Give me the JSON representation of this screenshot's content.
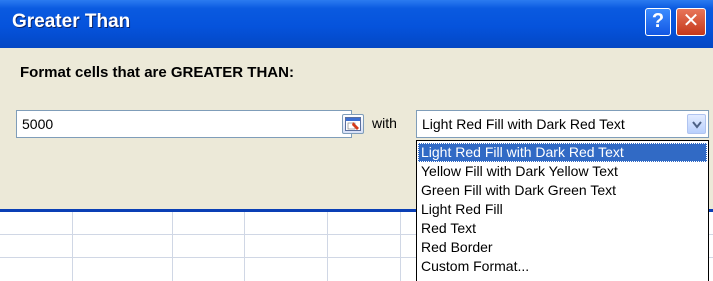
{
  "dialog": {
    "title": "Greater Than",
    "help_glyph": "?",
    "close_glyph": "✕",
    "prompt": "Format cells that are GREATER THAN:",
    "value": "5000",
    "with_label": "with",
    "format_selected": "Light Red Fill with Dark Red Text",
    "format_options": [
      "Light Red Fill with Dark Red Text",
      "Yellow Fill with Dark Yellow Text",
      "Green Fill with Dark Green Text",
      "Light Red Fill",
      "Red Text",
      "Red Border",
      "Custom Format..."
    ],
    "highlighted_index": 0
  },
  "icons": {
    "help": "help-icon",
    "close": "close-icon",
    "collapse": "collapse-dialog-icon",
    "dropdown": "chevron-down-icon"
  },
  "colors": {
    "title_bar": "#0553dc",
    "dialog_bg": "#ece9d8",
    "highlight": "#316ac5",
    "close_button": "#c4381b"
  }
}
